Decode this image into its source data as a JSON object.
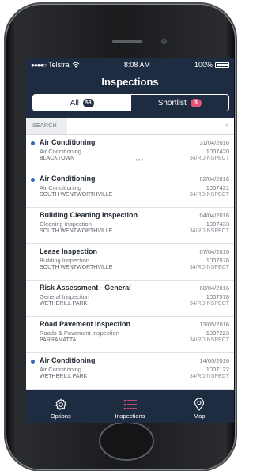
{
  "status_bar": {
    "carrier": "Telstra",
    "time": "8:08 AM",
    "battery": "100%"
  },
  "header": {
    "title": "Inspections"
  },
  "segments": {
    "all_label": "All",
    "all_count": "53",
    "shortlist_label": "Shortlist",
    "shortlist_count": "3"
  },
  "search": {
    "label": "SEARCH",
    "value": "",
    "clear": "×"
  },
  "inspections": [
    {
      "title": "Air Conditioning",
      "date": "31/04/2016",
      "type": "Air Conditioning",
      "number": "1007420",
      "location": "BLACKTOWN",
      "ref": "34/RDINSPECT",
      "dot": true
    },
    {
      "title": "Air Conditioning",
      "date": "02/04/2016",
      "type": "Air Conditioning",
      "number": "1007431",
      "location": "SOUTH WENTWORTHVILLE",
      "ref": "34/RDINSPECT",
      "dot": true
    },
    {
      "title": "Building Cleaning Inspection",
      "date": "04/04/2016",
      "type": "Cleaning Inspection",
      "number": "1007433",
      "location": "SOUTH WENTWORTHVILLE",
      "ref": "34/RDINSPECT",
      "dot": false
    },
    {
      "title": "Lease Inspection",
      "date": "07/04/2016",
      "type": "Building Inspection",
      "number": "1007576",
      "location": "SOUTH WENTWORTHVILLE",
      "ref": "34/RDINSPECT",
      "dot": false
    },
    {
      "title": "Risk Assessment - General",
      "date": "08/04/2016",
      "type": "General Inspection",
      "number": "1007578",
      "location": "WETHERILL PARK",
      "ref": "34/RDINSPECT",
      "dot": false
    },
    {
      "title": "Road Pavement Inspection",
      "date": "13/05/2016",
      "type": "Roads & Pavement Inspection",
      "number": "1007223",
      "location": "PARRAMATTA",
      "ref": "34/RDINSPECT",
      "dot": false
    },
    {
      "title": "Air Conditioning",
      "date": "14/05/2016",
      "type": "Air Conditioning",
      "number": "1007122",
      "location": "WETHERILL PARK",
      "ref": "34/RDINSPECT",
      "dot": true
    }
  ],
  "more_indicator": "•••",
  "tabbar": {
    "options_label": "Options",
    "inspections_label": "Inspections",
    "map_label": "Map"
  },
  "colors": {
    "navy": "#1d2c40",
    "accent_pink": "#e2527a",
    "unread_dot": "#2d6bb5"
  },
  "icons": {
    "options": "gear-icon",
    "inspections": "list-icon",
    "map": "map-pin-icon"
  }
}
